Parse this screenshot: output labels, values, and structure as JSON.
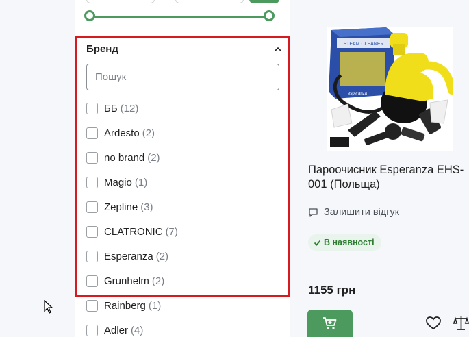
{
  "filters": {
    "brand": {
      "title": "Бренд",
      "search_placeholder": "Пошук",
      "items": [
        {
          "name": "ББ",
          "count": "(12)"
        },
        {
          "name": "Ardesto",
          "count": "(2)"
        },
        {
          "name": "no brand",
          "count": "(2)"
        },
        {
          "name": "Magio",
          "count": "(1)"
        },
        {
          "name": "Zepline",
          "count": "(3)"
        },
        {
          "name": "CLATRONIC",
          "count": "(7)"
        },
        {
          "name": "Esperanza",
          "count": "(2)"
        },
        {
          "name": "Grunhelm",
          "count": "(2)"
        },
        {
          "name": "Rainberg",
          "count": "(1)"
        },
        {
          "name": "Adler",
          "count": "(4)"
        }
      ]
    }
  },
  "product": {
    "title": "Пароочисник Esperanza EHS-001 (Польща)",
    "review_label": "Залишити відгук",
    "stock_label": "В наявності",
    "price": "1155 грн",
    "image_box_text": "STEAM CLEANER",
    "image_brand": "esperanza"
  },
  "colors": {
    "accent": "#4c9a5e",
    "highlight_border": "#d71920",
    "stock_bg": "#e8f4ec",
    "stock_text": "#2e7d32"
  }
}
